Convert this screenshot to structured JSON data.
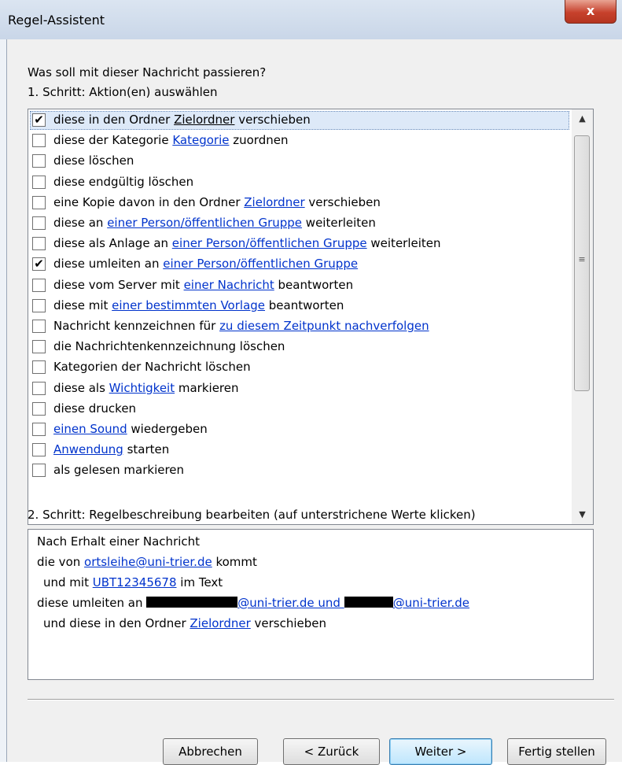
{
  "window": {
    "title": "Regel-Assistent",
    "close_glyph": "x"
  },
  "main": {
    "question": "Was soll mit dieser Nachricht passieren?",
    "step1_label": "1. Schritt: Aktion(en) auswählen",
    "step2_label": "2. Schritt: Regelbeschreibung bearbeiten (auf unterstrichene Werte klicken)"
  },
  "actions": [
    {
      "checked": true,
      "pre": "diese in den Ordner ",
      "link": "Zielordner",
      "post": " verschieben",
      "selected": true
    },
    {
      "checked": false,
      "pre": "diese der Kategorie ",
      "link": "Kategorie",
      "post": " zuordnen"
    },
    {
      "checked": false,
      "pre": "diese löschen",
      "link": "",
      "post": ""
    },
    {
      "checked": false,
      "pre": "diese endgültig löschen",
      "link": "",
      "post": ""
    },
    {
      "checked": false,
      "pre": "eine Kopie davon in den Ordner ",
      "link": "Zielordner",
      "post": " verschieben"
    },
    {
      "checked": false,
      "pre": "diese an ",
      "link": "einer Person/öffentlichen Gruppe",
      "post": " weiterleiten"
    },
    {
      "checked": false,
      "pre": "diese als Anlage an ",
      "link": "einer Person/öffentlichen Gruppe",
      "post": " weiterleiten"
    },
    {
      "checked": true,
      "pre": "diese umleiten an ",
      "link": "einer Person/öffentlichen Gruppe",
      "post": ""
    },
    {
      "checked": false,
      "pre": "diese vom Server mit ",
      "link": "einer Nachricht",
      "post": " beantworten"
    },
    {
      "checked": false,
      "pre": "diese mit ",
      "link": "einer bestimmten Vorlage",
      "post": " beantworten"
    },
    {
      "checked": false,
      "pre": "Nachricht kennzeichnen für ",
      "link": "zu diesem Zeitpunkt nachverfolgen",
      "post": ""
    },
    {
      "checked": false,
      "pre": "die Nachrichtenkennzeichnung löschen",
      "link": "",
      "post": ""
    },
    {
      "checked": false,
      "pre": "Kategorien der Nachricht löschen",
      "link": "",
      "post": ""
    },
    {
      "checked": false,
      "pre": "diese als ",
      "link": "Wichtigkeit",
      "post": " markieren"
    },
    {
      "checked": false,
      "pre": "diese drucken",
      "link": "",
      "post": ""
    },
    {
      "checked": false,
      "pre": "",
      "link": "einen Sound",
      "post": " wiedergeben"
    },
    {
      "checked": false,
      "pre": "",
      "link": "Anwendung",
      "post": " starten"
    },
    {
      "checked": false,
      "pre": "als gelesen markieren",
      "link": "",
      "post": ""
    }
  ],
  "scrollbar": {
    "up_glyph": "▲",
    "down_glyph": "▼",
    "grip_glyph": "≡"
  },
  "description": {
    "line1": "Nach Erhalt einer Nachricht",
    "line2_pre": "die von ",
    "line2_link": "ortsleihe@uni-trier.de",
    "line2_post": " kommt",
    "line3_pre": "und mit ",
    "line3_link": "UBT12345678",
    "line3_post": " im Text",
    "line4_pre": "diese umleiten an ",
    "line4_link_a": "@uni-trier.de und ",
    "line4_link_b": "@uni-trier.de",
    "line5_pre": "und diese in den Ordner ",
    "line5_link": "Zielordner",
    "line5_post": " verschieben"
  },
  "buttons": {
    "cancel": "Abbrechen",
    "back": "< Zurück",
    "next": "Weiter >",
    "finish": "Fertig stellen"
  },
  "colors": {
    "link": "#0033cc",
    "selection": "#dde9f8",
    "close": "#c7412c"
  }
}
